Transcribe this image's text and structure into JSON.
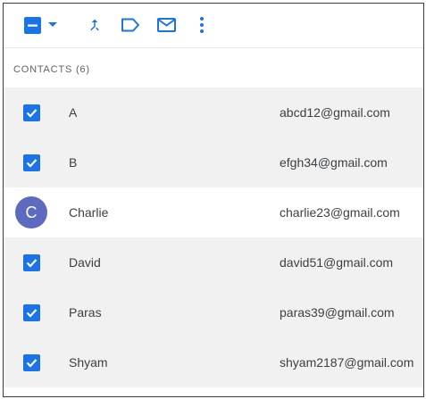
{
  "toolbar": {
    "accent_color": "#1a73e8",
    "icons": [
      "select-all-checkbox-icon",
      "dropdown-arrow-icon",
      "merge-icon",
      "label-icon",
      "email-icon",
      "more-vert-icon"
    ]
  },
  "section": {
    "title": "CONTACTS (6)"
  },
  "contacts": [
    {
      "name": "A",
      "email": "abcd12@gmail.com",
      "selected": true
    },
    {
      "name": "B",
      "email": "efgh34@gmail.com",
      "selected": true
    },
    {
      "name": "Charlie",
      "email": "charlie23@gmail.com",
      "selected": false,
      "avatar_letter": "C"
    },
    {
      "name": "David",
      "email": "david51@gmail.com",
      "selected": true
    },
    {
      "name": "Paras",
      "email": "paras39@gmail.com",
      "selected": true
    },
    {
      "name": "Shyam",
      "email": "shyam2187@gmail.com",
      "selected": true
    }
  ]
}
